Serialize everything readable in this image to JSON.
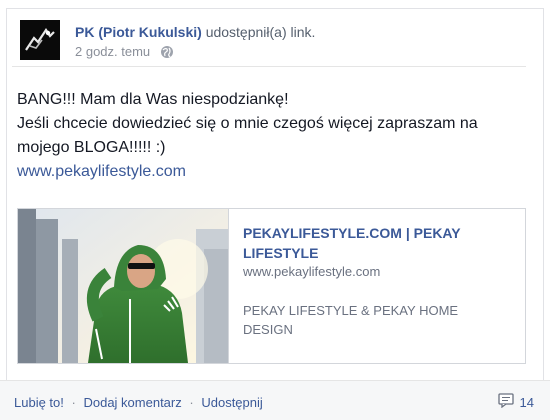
{
  "post": {
    "author": "PK (Piotr Kukulski)",
    "action": "udostępnił(a) link.",
    "time": "2 godz. temu",
    "privacy_icon": "globe-icon",
    "text_lines": [
      "BANG!!! Mam dla Was niespodziankę!",
      "Jeśli chcecie dowiedzieć się o mnie czegoś więcej zapraszam na",
      "mojego BLOGA!!!!! :)"
    ],
    "link": "www.pekaylifestyle.com"
  },
  "attachment": {
    "title_line1": "PEKAYLIFESTYLE.COM | PEKAY",
    "title_line2": "LIFESTYLE",
    "domain": "www.pekaylifestyle.com",
    "desc_line1": "PEKAY LIFESTYLE & PEKAY HOME",
    "desc_line2": "DESIGN"
  },
  "actions": {
    "like": "Lubię to!",
    "comment": "Dodaj komentarz",
    "share": "Udostępnij",
    "separator": "·",
    "comment_icon": "comment-icon",
    "comment_count": "14"
  },
  "colors": {
    "link": "#3b5998",
    "meta": "#8a8f99",
    "bar_bg": "#f6f7f8"
  }
}
